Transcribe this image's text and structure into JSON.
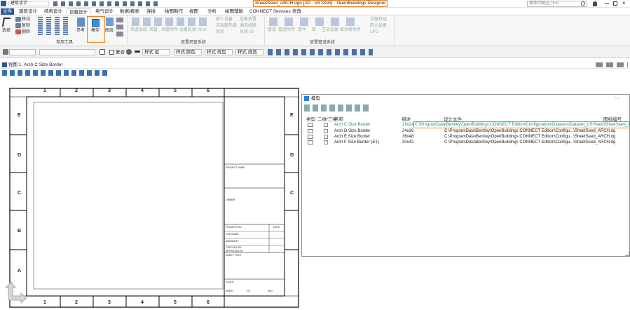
{
  "titlebar": {
    "quick_menu": "建筑设计",
    "document_title": "SheetSeed_ARCH.dgn [2D - V8 DGN] - OpenBuildings Designer",
    "search_placeholder": "搜索功能区 (F4)"
  },
  "tabs": [
    "文件",
    "建筑设计",
    "结构设计",
    "设备设计",
    "电气设计",
    "数据/报表",
    "连接",
    "绘图制作",
    "视图",
    "分析",
    "绘图辅助",
    "CONNECT Services",
    "修改"
  ],
  "active_tab": "设备设计",
  "ribbon": {
    "select_label": "选择",
    "edit_labels": [
      "移动",
      "复制",
      "删除"
    ],
    "ref_label": "参考",
    "model_label": "模型",
    "layer_label": "图层",
    "group_common": "常用工具",
    "hvac_items": [
      "风道系统",
      "风管",
      "风管附件",
      "设备机组",
      "AHU",
      "嵌入设备",
      "末端散热器",
      "风机"
    ],
    "hvac_small": [
      "设备放置",
      "通风线路",
      "系统 ID"
    ],
    "group_hvac": "放置风管系统",
    "pipe_items": [
      "管道",
      "管道附件",
      "管件",
      "泵",
      "卫浴设备",
      "给水排水件"
    ],
    "pipe_small": [
      "设备机组",
      "防火设备",
      "LPG"
    ],
    "group_pipe": "放置管道系统"
  },
  "toolbar": {
    "complex_label": "复合",
    "linestyle_items": [
      "样式 层",
      "样式 颜色",
      "样式 线型",
      "样式 线宽"
    ]
  },
  "view": {
    "title": "视图 1, Arch C Size Border"
  },
  "sheet": {
    "col_numbers": [
      "1",
      "2",
      "3",
      "4",
      "5",
      "6"
    ],
    "row_letters": [
      "E",
      "D",
      "C",
      "B",
      "A"
    ],
    "title_block": {
      "project_name": "PROJECT NAME",
      "owner": "OWNER",
      "project_no": "PROJECT NO.",
      "date": "DATE",
      "file": "FILE NAME",
      "drawn": "DRAWN BY",
      "checked": "CHECKED BY",
      "approved": "APPROVED BY",
      "sheet_title": "SHEET TITLE",
      "scale": "SCALE:",
      "sheet": "SHEET",
      "of": "OF",
      "rev": "REV."
    }
  },
  "models_panel": {
    "title": "模型",
    "columns": [
      "类型",
      "二维/三维",
      "名称",
      "描述",
      "设计文件",
      "图纸编号"
    ],
    "rows": [
      {
        "name": "Arch C Size Border",
        "description": "18x24",
        "design_file": "C:\\ProgramData\\Bentley\\OpenBuildings CONNECT Edition\\Configuration\\Datasets\\Dataset_US\\Seed\\SheetSeed_ARCH.dgn",
        "selected": true
      },
      {
        "name": "Arch D Size Border",
        "description": "24x36",
        "design_file": "C:\\ProgramData\\Bentley\\OpenBuildings CONNECT Edition\\Configu...\\SheetSeed_ARCH.dg",
        "selected": false
      },
      {
        "name": "Arch E Size Border",
        "description": "36x48",
        "design_file": "C:\\ProgramData\\Bentley\\OpenBuildings CONNECT Edition\\Configu...\\SheetSeed_ARCH.dg",
        "selected": false
      },
      {
        "name": "Arch F Size Border (E1)",
        "description": "30x42",
        "design_file": "C:\\ProgramData\\Bentley\\OpenBuildings CONNECT Edition\\Configu...\\SheetSeed_ARCH.dg",
        "selected": false
      }
    ]
  },
  "colors": {
    "accent": "#2b579a",
    "highlight": "#f07f1e",
    "selected_text": "#1f8f66"
  }
}
